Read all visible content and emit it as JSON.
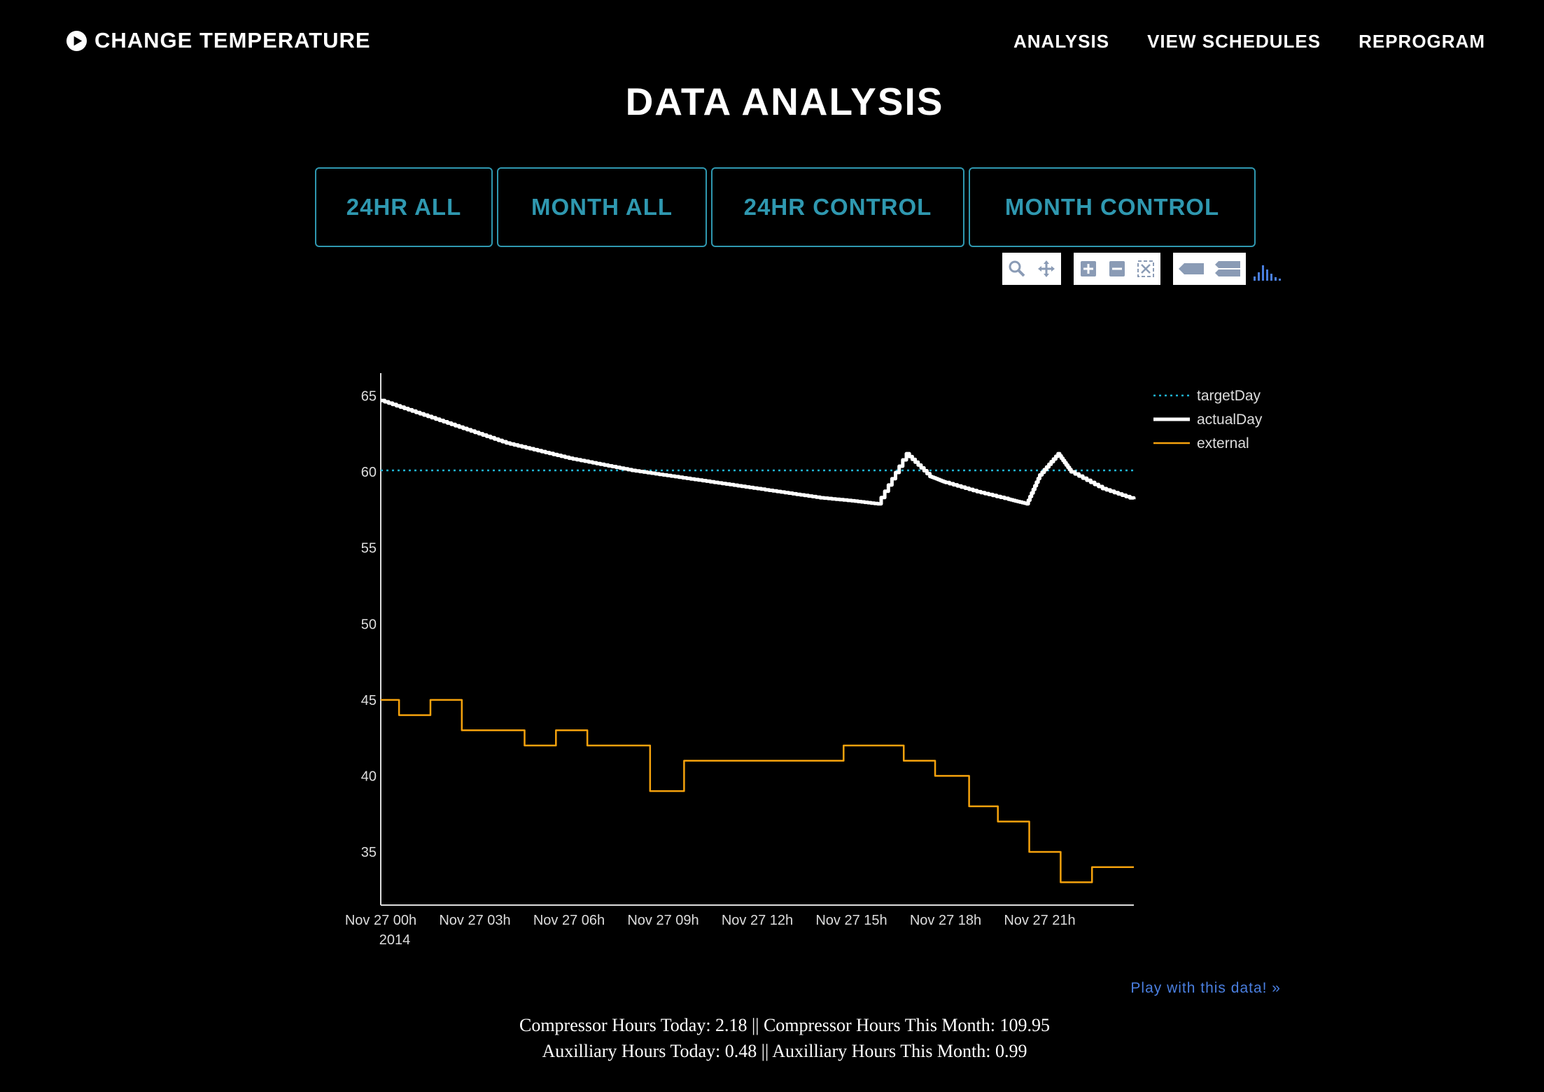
{
  "nav": {
    "brand": "CHANGE TEMPERATURE",
    "links": [
      "ANALYSIS",
      "VIEW SCHEDULES",
      "REPROGRAM"
    ]
  },
  "page_title": "DATA ANALYSIS",
  "tabs": [
    "24HR ALL",
    "MONTH ALL",
    "24HR CONTROL",
    "MONTH CONTROL"
  ],
  "modebar_icons": [
    "zoom-icon",
    "pan-icon",
    "zoom-in-icon",
    "zoom-out-icon",
    "autoscale-icon",
    "hover-closest-icon",
    "hover-compare-icon",
    "plotly-logo-icon"
  ],
  "colors": {
    "accent": "#2f98b0",
    "target": "#1fb4d6",
    "actual": "#ffffff",
    "external": "#f5a20d",
    "link": "#4a7fe0"
  },
  "chart_data": {
    "type": "line",
    "xlabel": "",
    "ylabel": "",
    "x_ticks": [
      "Nov 27 00h",
      "Nov 27 03h",
      "Nov 27 06h",
      "Nov 27 09h",
      "Nov 27 12h",
      "Nov 27 15h",
      "Nov 27 18h",
      "Nov 27 21h"
    ],
    "x_sub_label": "2014",
    "y_ticks": [
      35,
      40,
      45,
      50,
      55,
      60,
      65
    ],
    "ylim": [
      31.5,
      66.5
    ],
    "xlim": [
      "2014-11-27 00:00",
      "2014-11-27 24:00"
    ],
    "legend_position": "top-right",
    "series": [
      {
        "name": "targetDay",
        "style": "dotted",
        "points": [
          [
            "2014-11-27 00:00",
            60.1
          ],
          [
            "2014-11-27 24:00",
            60.1
          ]
        ]
      },
      {
        "name": "actualDay",
        "style": "thick",
        "points": [
          [
            "2014-11-27 00:00",
            64.7
          ],
          [
            "2014-11-27 01:00",
            64.0
          ],
          [
            "2014-11-27 02:00",
            63.3
          ],
          [
            "2014-11-27 03:00",
            62.6
          ],
          [
            "2014-11-27 04:00",
            61.9
          ],
          [
            "2014-11-27 05:00",
            61.4
          ],
          [
            "2014-11-27 06:00",
            60.9
          ],
          [
            "2014-11-27 07:00",
            60.5
          ],
          [
            "2014-11-27 08:00",
            60.1
          ],
          [
            "2014-11-27 09:00",
            59.8
          ],
          [
            "2014-11-27 10:00",
            59.5
          ],
          [
            "2014-11-27 11:00",
            59.2
          ],
          [
            "2014-11-27 12:00",
            58.9
          ],
          [
            "2014-11-27 13:00",
            58.6
          ],
          [
            "2014-11-27 14:00",
            58.3
          ],
          [
            "2014-11-27 15:00",
            58.1
          ],
          [
            "2014-11-27 15:50",
            57.9
          ],
          [
            "2014-11-27 16:45",
            61.2
          ],
          [
            "2014-11-27 17:30",
            59.7
          ],
          [
            "2014-11-27 18:00",
            59.3
          ],
          [
            "2014-11-27 19:00",
            58.7
          ],
          [
            "2014-11-27 20:00",
            58.2
          ],
          [
            "2014-11-27 20:35",
            57.9
          ],
          [
            "2014-11-27 21:00",
            59.8
          ],
          [
            "2014-11-27 21:35",
            61.2
          ],
          [
            "2014-11-27 22:00",
            60.0
          ],
          [
            "2014-11-27 23:00",
            58.9
          ],
          [
            "2014-11-27 24:00",
            58.2
          ]
        ]
      },
      {
        "name": "external",
        "style": "step",
        "points": [
          [
            "2014-11-27 00:00",
            45
          ],
          [
            "2014-11-27 00:35",
            44
          ],
          [
            "2014-11-27 01:35",
            45
          ],
          [
            "2014-11-27 02:35",
            43
          ],
          [
            "2014-11-27 04:35",
            42
          ],
          [
            "2014-11-27 05:35",
            43
          ],
          [
            "2014-11-27 06:35",
            42
          ],
          [
            "2014-11-27 08:35",
            39
          ],
          [
            "2014-11-27 09:40",
            41
          ],
          [
            "2014-11-27 14:45",
            42
          ],
          [
            "2014-11-27 16:40",
            41
          ],
          [
            "2014-11-27 17:40",
            40
          ],
          [
            "2014-11-27 18:45",
            38
          ],
          [
            "2014-11-27 19:40",
            37
          ],
          [
            "2014-11-27 20:40",
            35
          ],
          [
            "2014-11-27 21:40",
            33
          ],
          [
            "2014-11-27 22:40",
            34
          ],
          [
            "2014-11-27 24:00",
            34
          ]
        ]
      }
    ]
  },
  "play_link": "Play with this data! »",
  "stats": {
    "line1": "Compressor Hours Today: 2.18 || Compressor Hours This Month: 109.95",
    "line2": "Auxilliary Hours Today: 0.48 || Auxilliary Hours This Month: 0.99"
  }
}
